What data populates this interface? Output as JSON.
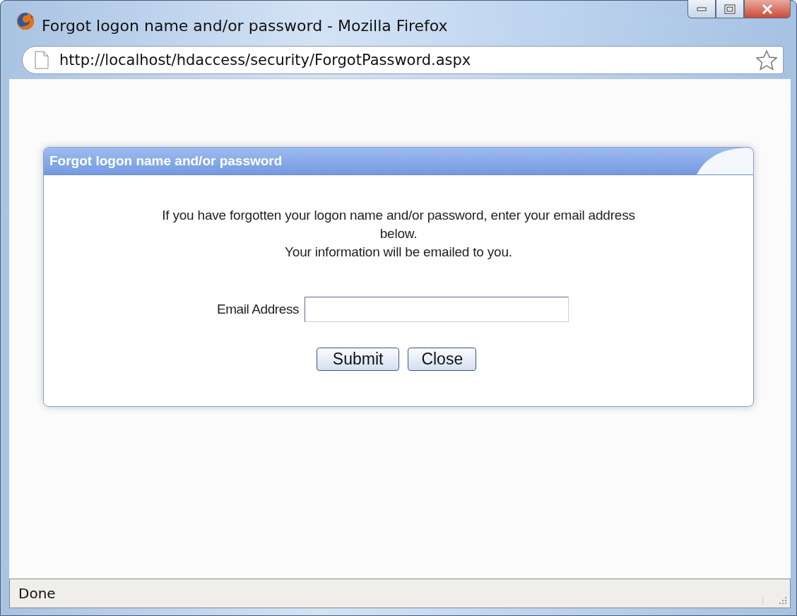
{
  "window": {
    "title": "Forgot logon name and/or password - Mozilla Firefox"
  },
  "address_bar": {
    "url": "http://localhost/hdaccess/security/ForgotPassword.aspx"
  },
  "dialog": {
    "title": "Forgot logon name and/or password",
    "message": [
      "If you have forgotten your logon name and/or password, enter your email address below.",
      "Your information will be emailed to you."
    ],
    "field": {
      "label": "Email Address"
    },
    "buttons": [
      "Submit",
      "Close"
    ]
  },
  "status_bar": {
    "text": "Done"
  }
}
